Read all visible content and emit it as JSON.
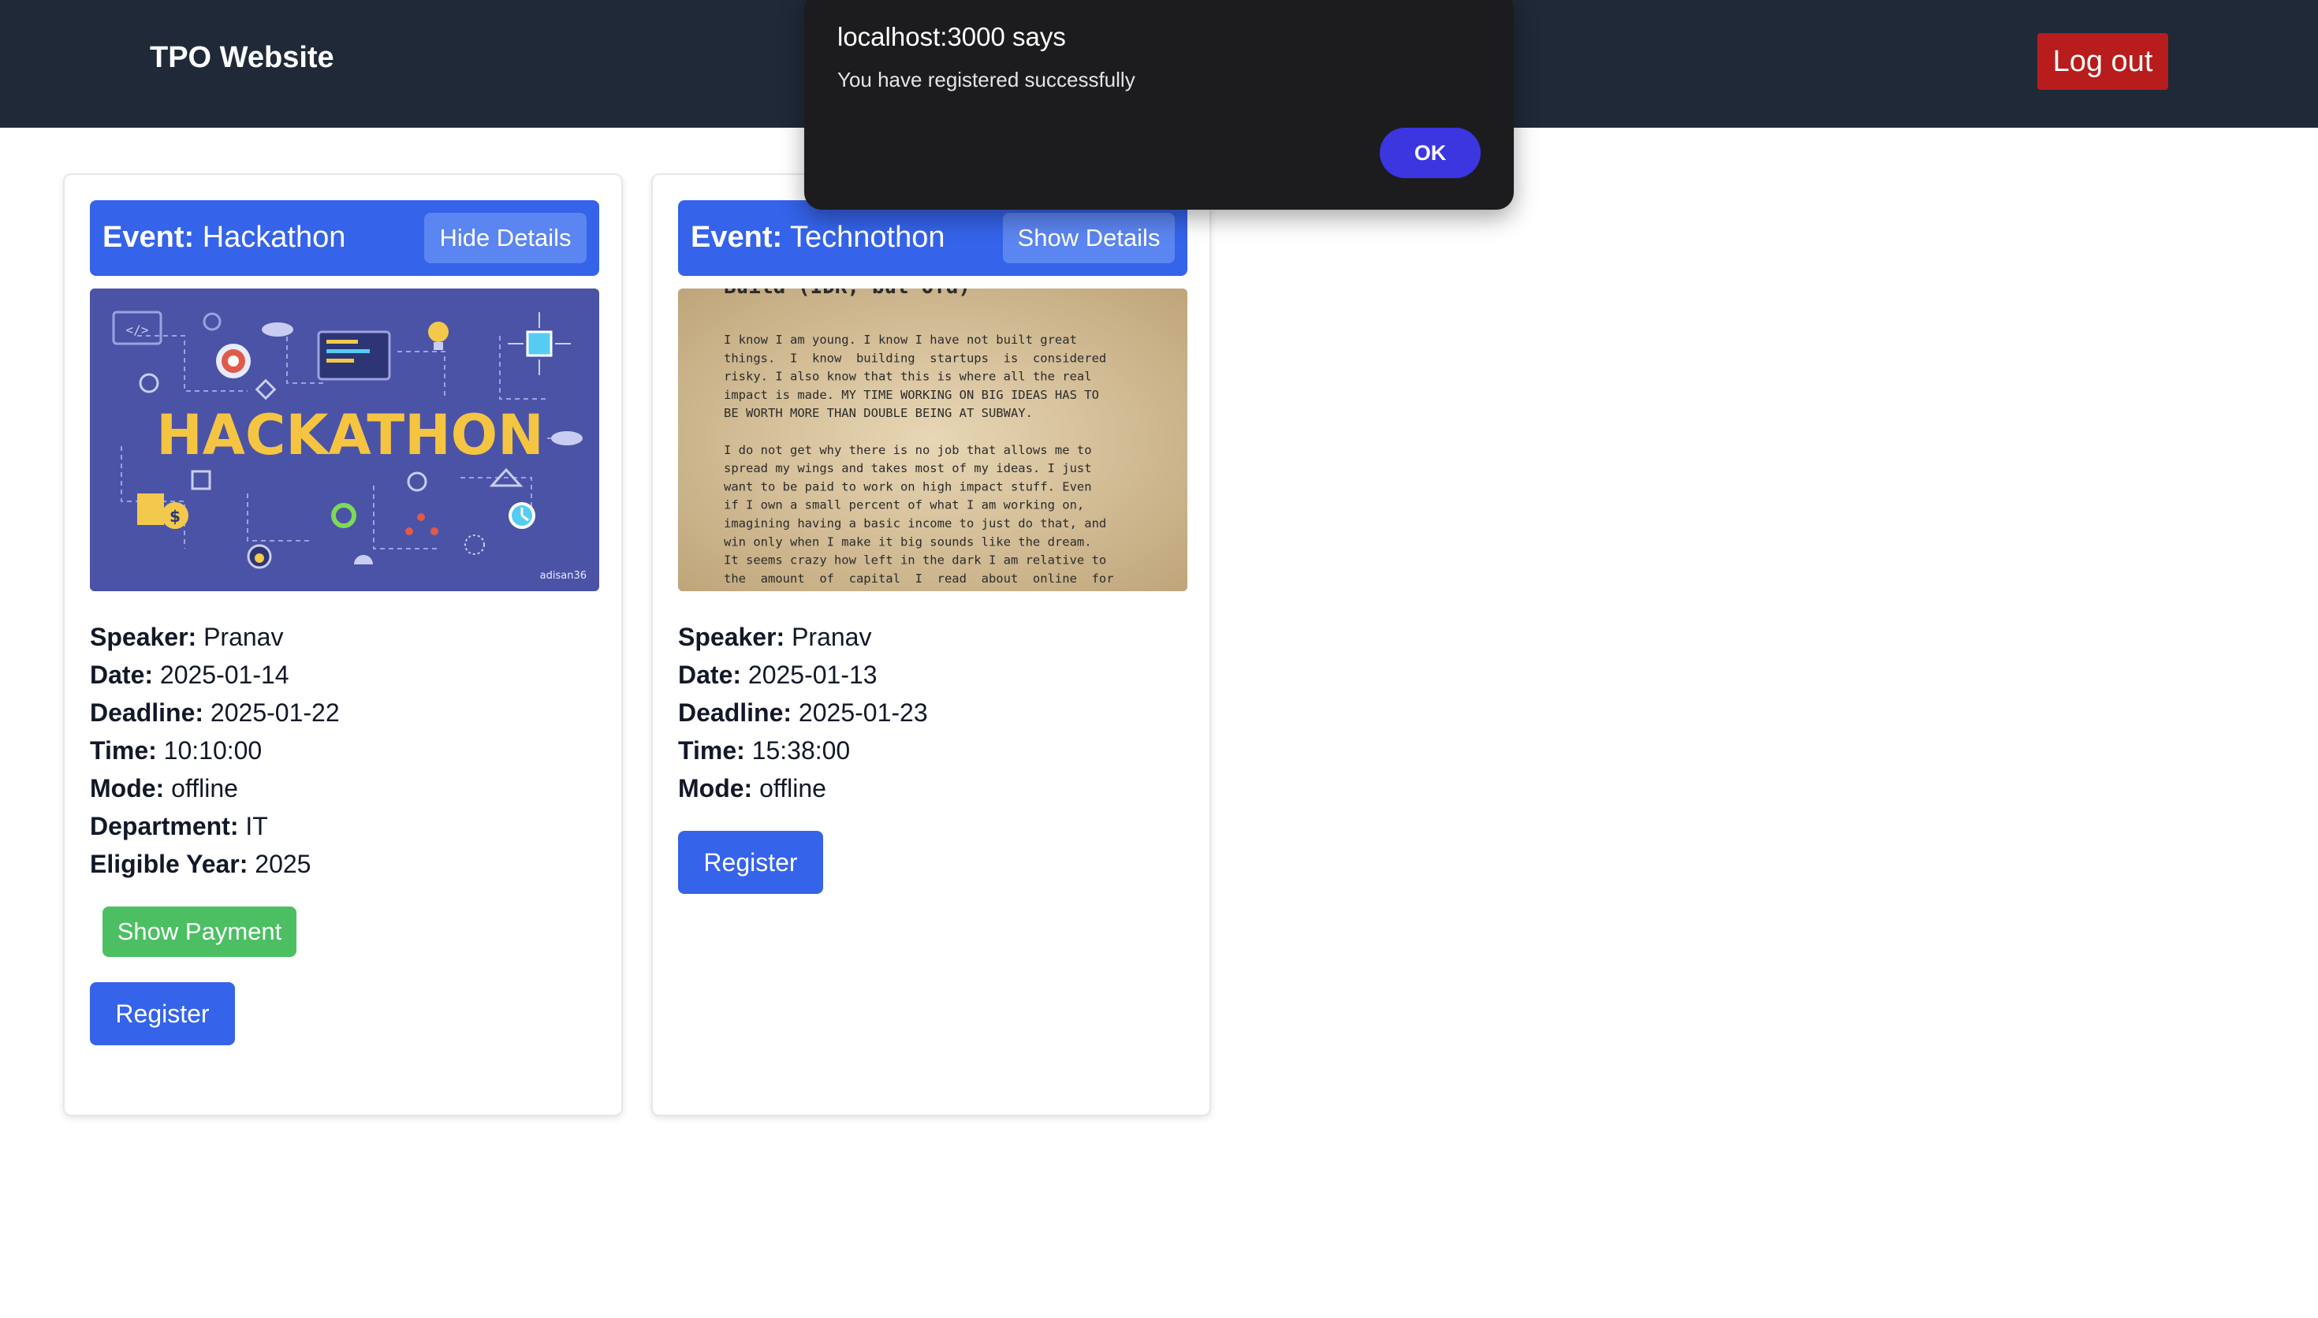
{
  "navbar": {
    "brand": "TPO Website",
    "logout_label": "Log out"
  },
  "dialog": {
    "title": "localhost:3000 says",
    "message": "You have registered successfully",
    "ok_label": "OK"
  },
  "events": [
    {
      "label_prefix": "Event:",
      "name": "Hackathon",
      "details_button": "Hide Details",
      "image_text": "HACKATHON",
      "image_corner_text": "adisan36",
      "speaker_label": "Speaker:",
      "speaker": "Pranav",
      "date_label": "Date:",
      "date": "2025-01-14",
      "deadline_label": "Deadline:",
      "deadline": "2025-01-22",
      "time_label": "Time:",
      "time": "10:10:00",
      "mode_label": "Mode:",
      "mode": "offline",
      "department_label": "Department:",
      "department": "IT",
      "year_label": "Eligible Year:",
      "year": "2025",
      "payment_button": "Show Payment",
      "register_button": "Register"
    },
    {
      "label_prefix": "Event:",
      "name": "Technothon",
      "details_button": "Show Details",
      "image_heading": "Build (IDK, but Ofd)",
      "image_lines": [
        "I know I am young. I know I have not built great",
        "things.  I  know  building  startups  is  considered",
        "risky. I also know that this is where all the real",
        "impact is made. MY TIME WORKING ON BIG IDEAS HAS TO",
        "BE WORTH MORE THAN DOUBLE BEING AT SUBWAY.",
        "",
        "I do not get why there is no job that allows me to",
        "spread my wings and takes most of my ideas. I just",
        "want to be paid to work on high impact stuff. Even",
        "if I own a small percent of what I am working on,",
        "imagining having a basic income to just do that, and",
        "win only when I make it big sounds like the dream.",
        "It seems crazy how left in the dark I am relative to",
        "the  amount  of  capital  I  read  about  online  for"
      ],
      "speaker_label": "Speaker:",
      "speaker": "Pranav",
      "date_label": "Date:",
      "date": "2025-01-13",
      "deadline_label": "Deadline:",
      "deadline": "2025-01-23",
      "time_label": "Time:",
      "time": "15:38:00",
      "mode_label": "Mode:",
      "mode": "offline",
      "register_button": "Register"
    }
  ],
  "colors": {
    "navbar": "#1f2937",
    "logout": "#b91c1c",
    "primary": "#3563e9",
    "payment": "#4cbf62",
    "dialog": "#1c1c1e",
    "dialog_ok": "#3b36e0"
  }
}
